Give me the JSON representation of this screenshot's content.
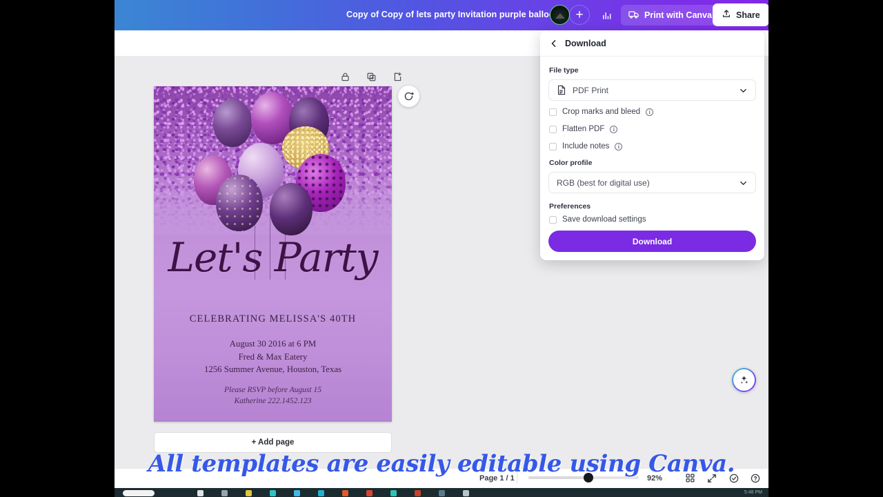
{
  "topbar": {
    "doc_title": "Copy of Copy of lets party Invitation purple balloon",
    "avatar_name": "user-avatar",
    "plus_label": "+",
    "chart_icon": "bar-chart-icon",
    "print_label": "Print with Canva",
    "print_icon": "truck-icon",
    "share_label": "Share",
    "share_icon": "upload-icon",
    "gradient_start": "#3b86d4",
    "gradient_end": "#8228e8"
  },
  "page_tools": {
    "lock": "lock-icon",
    "duplicate": "duplicate-icon",
    "add": "add-page-icon"
  },
  "regenerate": {
    "icon": "regenerate-icon"
  },
  "card": {
    "script_title": "Let's Party",
    "heading": "CELEBRATING MELISSA'S 40TH",
    "line1": "August 30 2016 at 6 PM",
    "line2": "Fred & Max Eatery",
    "line3": "1256 Summer Avenue, Houston, Texas",
    "rsvp1": "Please RSVP before August 15",
    "rsvp2": "Katherine 222.1452.123",
    "bg_color": "#c496dd",
    "ink_color": "#3e1247"
  },
  "add_page": {
    "label": "+ Add page"
  },
  "bottom_bar": {
    "page_count": "Page 1 / 1",
    "zoom": "92%",
    "grid_icon": "grid-view-icon",
    "expand_icon": "fullscreen-icon",
    "check_icon": "check-circle-icon",
    "help_icon": "help-icon"
  },
  "ai_button": {
    "icon": "sparkle-icon"
  },
  "download_panel": {
    "back_icon": "chevron-left-icon",
    "title": "Download",
    "file_type_label": "File type",
    "file_type_value": "PDF Print",
    "file_type_icon": "document-icon",
    "options": [
      {
        "label": "Crop marks and bleed",
        "checked": false
      },
      {
        "label": "Flatten PDF",
        "checked": false
      },
      {
        "label": "Include notes",
        "checked": false
      }
    ],
    "color_profile_label": "Color profile",
    "color_profile_value": "RGB (best for digital use)",
    "preferences_label": "Preferences",
    "save_settings_label": "Save download settings",
    "download_button": "Download",
    "button_color": "#7a2be3"
  },
  "overlay": {
    "caption": "All templates are easily editable using Canva."
  },
  "taskbar": {
    "time": "5:48 PM"
  }
}
